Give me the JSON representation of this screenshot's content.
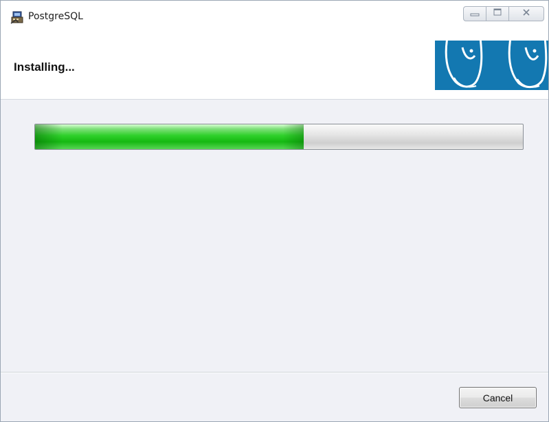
{
  "window": {
    "title": "PostgreSQL",
    "icons": {
      "app": "installer-icon",
      "minimize": "minimize-icon",
      "maximize": "maximize-icon",
      "close": "close-icon"
    }
  },
  "header": {
    "title": "Installing...",
    "logo": "postgresql-elephant-logo",
    "logo_color": "#1378b1"
  },
  "progress": {
    "fraction": 0.55,
    "fill_color": "#2fd02b"
  },
  "footer": {
    "cancel_label": "Cancel"
  }
}
